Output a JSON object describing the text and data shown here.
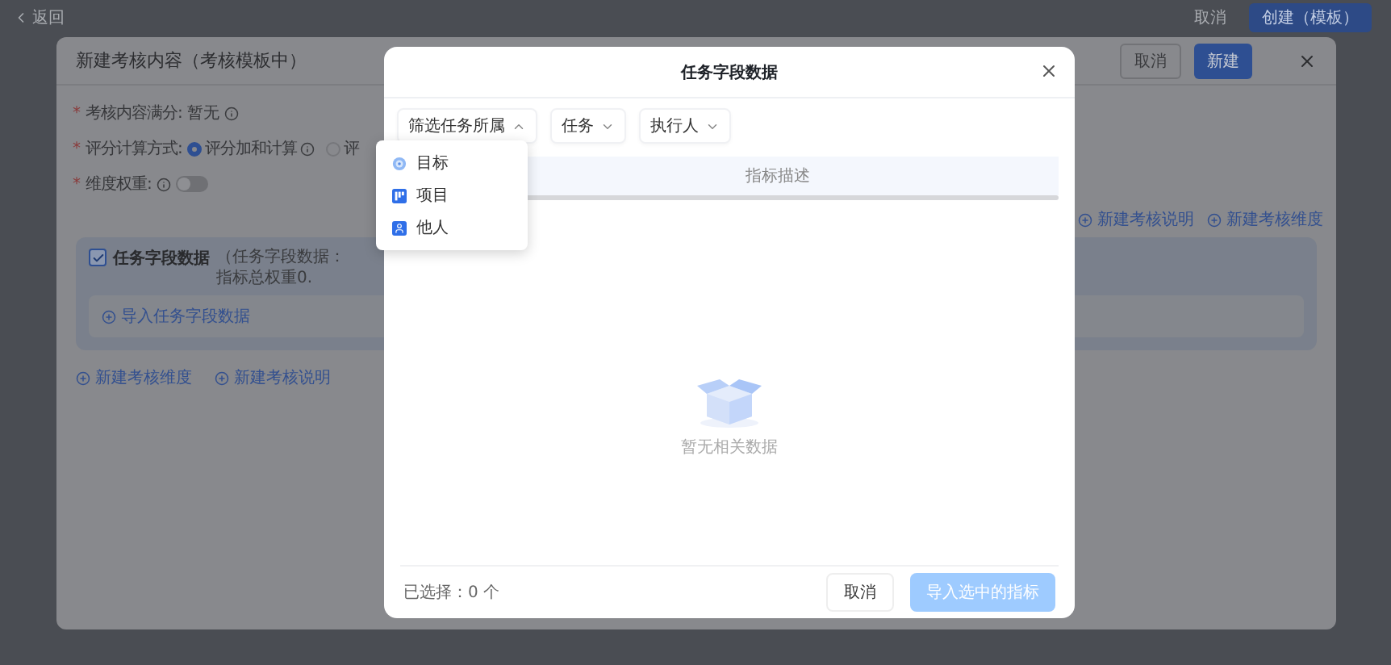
{
  "page": {
    "back_link": "返回",
    "cancel_button": "取消",
    "create_button": "创建（模板）"
  },
  "panel": {
    "title": "新建考核内容（考核模板中）",
    "cancel_button": "取消",
    "new_button": "新建",
    "form": [
      {
        "kind": "text",
        "required_mark": "*",
        "label": "考核内容满分:",
        "value": "暂无",
        "info": true
      },
      {
        "kind": "radio",
        "required_mark": "*",
        "label": "评分计算方式:",
        "options": [
          {
            "label": "评分加和计算",
            "selected": true,
            "info": true
          },
          {
            "label": "评",
            "selected": false
          }
        ]
      },
      {
        "kind": "switch",
        "required_mark": "*",
        "label": "维度权重:",
        "info": true,
        "on": false
      }
    ],
    "top_links": [
      "新建考核说明",
      "新建考核维度"
    ],
    "section": {
      "title": "任务字段数据",
      "checked": true,
      "note": "（任务字段数据：指标总权重0.",
      "import_link": "导入任务字段数据"
    },
    "bottom_links": [
      "新建考核维度",
      "新建考核说明"
    ]
  },
  "modal": {
    "title": "任务字段数据",
    "filters": [
      {
        "label": "筛选任务所属",
        "open": true
      },
      {
        "label": "任务",
        "open": false
      },
      {
        "label": "执行人",
        "open": false
      }
    ],
    "dropdown": [
      {
        "label": "目标",
        "kind": "goal"
      },
      {
        "label": "项目",
        "kind": "project"
      },
      {
        "label": "他人",
        "kind": "person"
      }
    ],
    "table": {
      "columns": [
        "指标描述"
      ]
    },
    "empty_text": "暂无相关数据",
    "selected_count": "已选择：0 个",
    "cancel_button": "取消",
    "import_button": {
      "label": "导入选中的指标",
      "disabled": true
    }
  }
}
